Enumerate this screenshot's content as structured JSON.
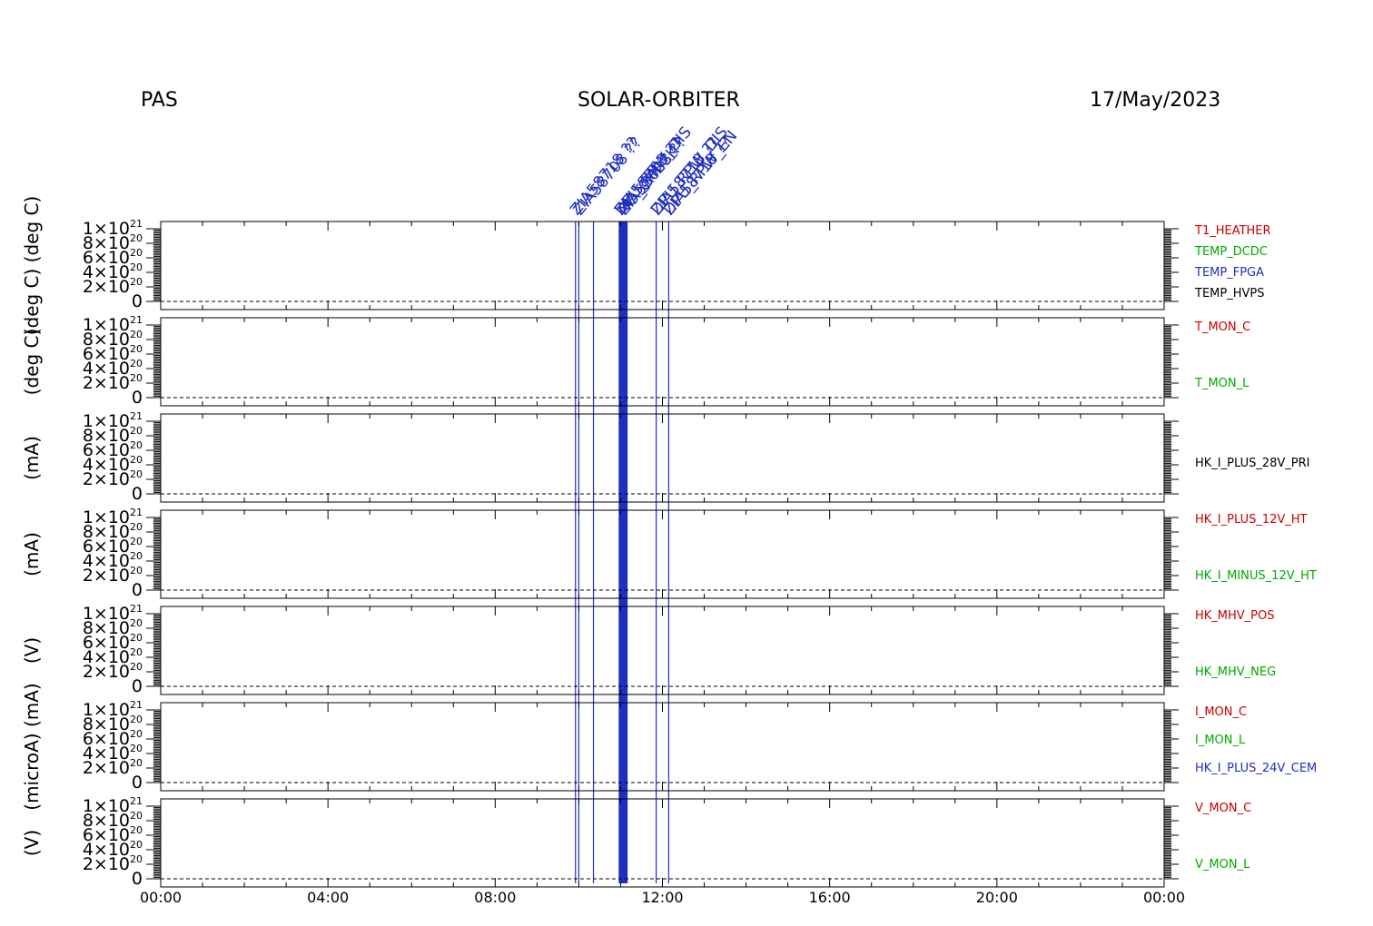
{
  "header": {
    "left": "PAS",
    "center": "SOLAR-ORBITER",
    "right": "17/May/2023"
  },
  "colors": {
    "axis": "#000000",
    "event_line": "#1f2fbf",
    "red": "#cc0000",
    "green": "#00aa00",
    "blue": "#1f2fbf",
    "black": "#000000"
  },
  "events": {
    "times_hours": [
      9.92,
      10.0,
      10.35,
      10.98,
      11.02,
      11.06,
      11.1,
      11.14,
      11.85,
      12.15
    ],
    "labels": [
      {
        "text": "ZIA58718 ??",
        "hour": 9.92
      },
      {
        "text": "ZIA58708 ??",
        "hour": 10.0
      },
      {
        "text": "ZIA58703 ??",
        "hour": 10.98
      },
      {
        "text": "ZIA58003 ??",
        "hour": 11.06
      },
      {
        "text": "ZIA58718 ??",
        "hour": 11.85
      },
      {
        "text": "ZIA58718 ??",
        "hour": 12.15
      },
      {
        "text": "DPU_RPW_DIS",
        "hour": 11.85
      },
      {
        "text": "DPU_RPW_EN",
        "hour": 12.15
      },
      {
        "text": "NO_CHECK",
        "hour": 11.06
      },
      {
        "text": "DPU_RPW_DIS",
        "hour": 10.98
      }
    ]
  },
  "chart_data": {
    "type": "line",
    "xlim": [
      "00:00",
      "24:00"
    ],
    "x_tick_labels": [
      "00:00",
      "04:00",
      "08:00",
      "12:00",
      "16:00",
      "20:00",
      "00:00"
    ],
    "x_tick_hours": [
      0,
      4,
      8,
      12,
      16,
      20,
      24
    ],
    "ylim": [
      0,
      1e+21
    ],
    "y_tick_labels": [
      {
        "mant": "0",
        "exp": ""
      },
      {
        "mant": "2×10",
        "exp": "20"
      },
      {
        "mant": "4×10",
        "exp": "20"
      },
      {
        "mant": "6×10",
        "exp": "20"
      },
      {
        "mant": "8×10",
        "exp": "20"
      },
      {
        "mant": "1×10",
        "exp": "21"
      }
    ],
    "y_tick_values": [
      0,
      2e+20,
      4e+20,
      6e+20,
      8e+20,
      1e+21
    ],
    "panels": [
      {
        "ylabel": "(deg C)  (deg C)",
        "series": [
          {
            "name": "T1_HEATHER",
            "color": "#cc0000"
          },
          {
            "name": "TEMP_DCDC",
            "color": "#00aa00"
          },
          {
            "name": "TEMP_FPGA",
            "color": "#1f2fbf"
          },
          {
            "name": "TEMP_HVPS",
            "color": "#000000"
          }
        ]
      },
      {
        "ylabel": "(deg C)",
        "series": [
          {
            "name": "T_MON_C",
            "color": "#cc0000"
          },
          {
            "name": "T_MON_L",
            "color": "#00aa00"
          }
        ]
      },
      {
        "ylabel": "(mA)",
        "series": [
          {
            "name": "HK_I_PLUS_28V_PRI",
            "color": "#000000"
          }
        ]
      },
      {
        "ylabel": "(mA)",
        "series": [
          {
            "name": "HK_I_PLUS_12V_HT",
            "color": "#cc0000"
          },
          {
            "name": "HK_I_MINUS_12V_HT",
            "color": "#00aa00"
          }
        ]
      },
      {
        "ylabel": "(V)",
        "series": [
          {
            "name": "HK_MHV_POS",
            "color": "#cc0000"
          },
          {
            "name": "HK_MHV_NEG",
            "color": "#00aa00"
          }
        ]
      },
      {
        "ylabel": "(microA)  (mA)",
        "series": [
          {
            "name": "I_MON_C",
            "color": "#cc0000"
          },
          {
            "name": "I_MON_L",
            "color": "#00aa00"
          },
          {
            "name": "HK_I_PLUS_24V_CEM",
            "color": "#1f2fbf"
          }
        ]
      },
      {
        "ylabel": "(V)",
        "series": [
          {
            "name": "V_MON_C",
            "color": "#cc0000"
          },
          {
            "name": "V_MON_L",
            "color": "#00aa00"
          }
        ]
      }
    ]
  }
}
